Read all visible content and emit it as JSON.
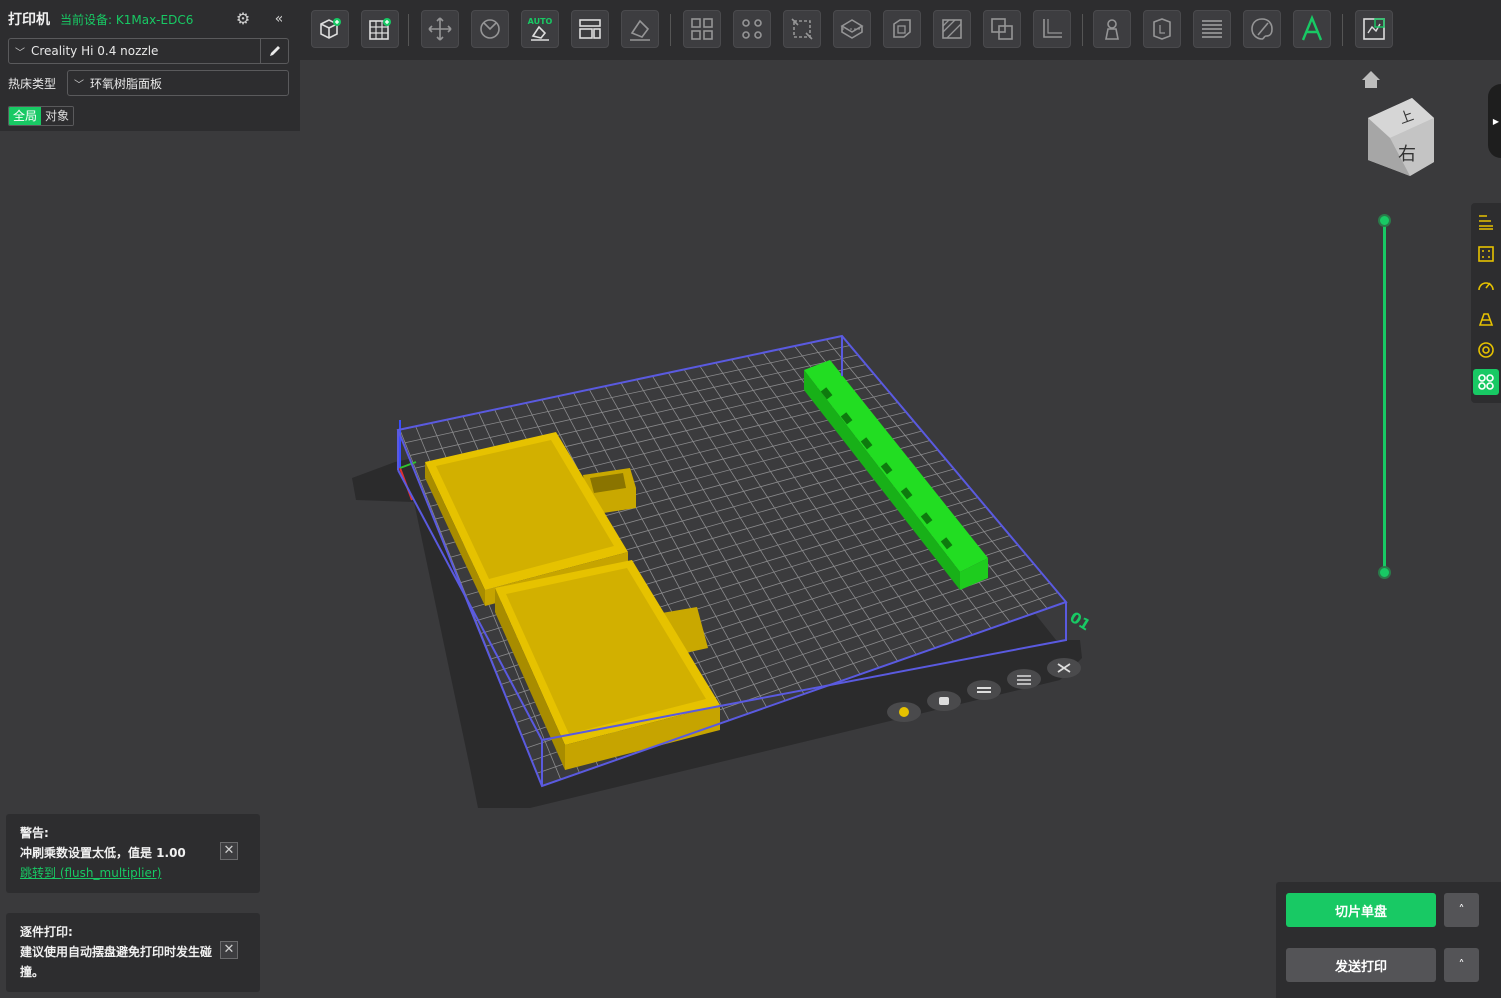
{
  "printer_panel": {
    "title": "打印机",
    "current_device": "当前设备: K1Max-EDC6",
    "nozzle_preset": "Creality Hi 0.4 nozzle",
    "bed_type_label": "热床类型",
    "bed_type_value": "环氧树脂面板",
    "scope_global": "全局",
    "scope_object": "对象"
  },
  "toolbar": {
    "auto_label": "AUTO",
    "icons": [
      "add-object-icon",
      "plate-grid-icon",
      "move-icon",
      "rotate-icon",
      "auto-orient-icon",
      "arrange-icon",
      "lay-flat-icon",
      "split-objects-icon",
      "split-parts-icon",
      "scale-icon",
      "cut-icon",
      "hollow-icon",
      "support-paint-icon",
      "boolean-icon",
      "measure-icon",
      "seam-paint-icon",
      "variable-layer-icon",
      "layers-icon",
      "color-paint-icon",
      "text-icon",
      "assembly-view-icon"
    ]
  },
  "viewcube": {
    "top_face": "上",
    "front_face": "右"
  },
  "plate": {
    "number": "01"
  },
  "notices": {
    "warning": {
      "title": "警告:",
      "body": "冲刷乘数设置太低，值是 1.00",
      "link": "跳转到 (flush_multiplier)"
    },
    "sequential": {
      "title": "逐件打印:",
      "body": "建议使用自动摆盘避免打印时发生碰撞。"
    }
  },
  "actions": {
    "slice_label": "切片单盘",
    "print_label": "发送打印",
    "more_glyph": "˄"
  },
  "colors": {
    "accent": "#18c964",
    "object_yellow": "#e6c200",
    "object_green": "#22dd22",
    "bounding_box": "#5a5ae0",
    "bed_dark": "#2b2b2c"
  }
}
